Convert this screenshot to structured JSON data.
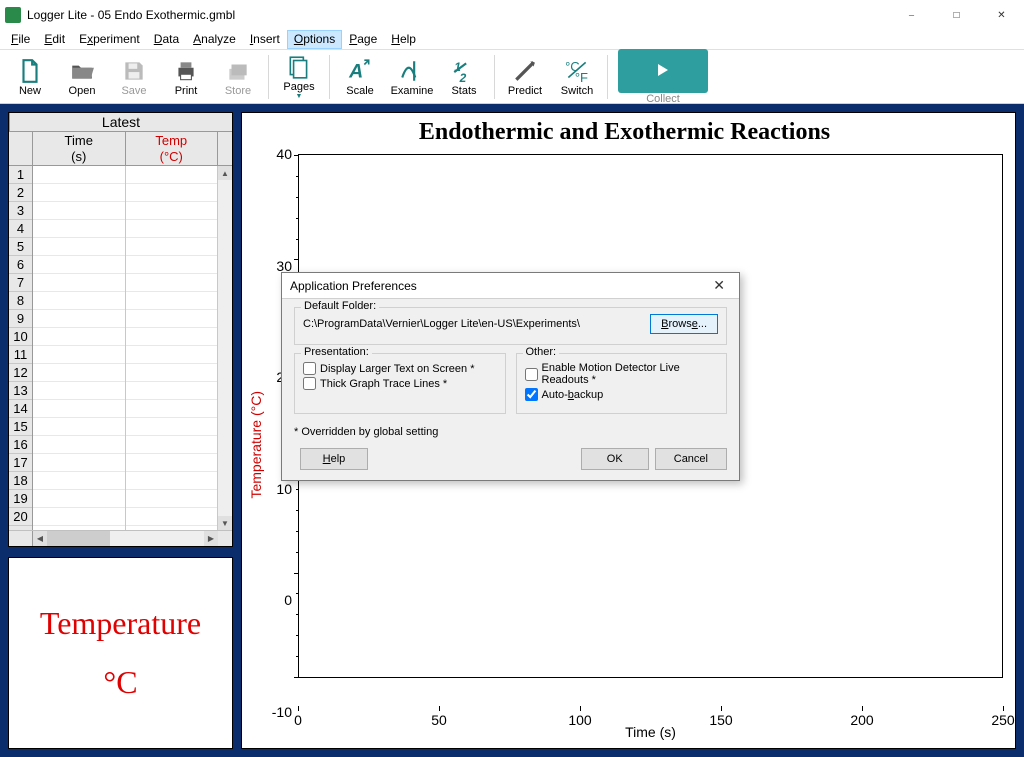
{
  "title": "Logger Lite - 05 Endo Exothermic.gmbl",
  "menu": [
    "File",
    "Edit",
    "Experiment",
    "Data",
    "Analyze",
    "Insert",
    "Options",
    "Page",
    "Help"
  ],
  "active_menu": "Options",
  "toolbar": {
    "new": "New",
    "open": "Open",
    "save": "Save",
    "print": "Print",
    "store": "Store",
    "pages": "Pages",
    "scale": "Scale",
    "examine": "Examine",
    "stats": "Stats",
    "predict": "Predict",
    "switch": "Switch",
    "collect": "Collect"
  },
  "table": {
    "title": "Latest",
    "col1_name": "Time",
    "col1_unit": "(s)",
    "col2_name": "Temp",
    "col2_unit": "(°C)",
    "rows": [
      1,
      2,
      3,
      4,
      5,
      6,
      7,
      8,
      9,
      10,
      11,
      12,
      13,
      14,
      15,
      16,
      17,
      18,
      19,
      20
    ]
  },
  "readout": {
    "label": "Temperature",
    "unit": "°C"
  },
  "chart_data": {
    "type": "line",
    "title": "Endothermic and Exothermic Reactions",
    "xlabel": "Time (s)",
    "ylabel": "Temperature (°C)",
    "xlim": [
      0,
      250
    ],
    "ylim": [
      -10,
      40
    ],
    "x_ticks": [
      0,
      50,
      100,
      150,
      200,
      250
    ],
    "y_ticks": [
      -10,
      0,
      10,
      20,
      30,
      40
    ],
    "series": []
  },
  "dialog": {
    "title": "Application Preferences",
    "default_folder_label": "Default Folder:",
    "default_folder_path": "C:\\ProgramData\\Vernier\\Logger Lite\\en-US\\Experiments\\",
    "browse": "Browse...",
    "presentation_label": "Presentation:",
    "larger_text": "Display Larger Text on Screen *",
    "thick_lines": "Thick Graph Trace Lines *",
    "other_label": "Other:",
    "motion_readouts": "Enable Motion Detector Live Readouts *",
    "auto_backup": "Auto-backup",
    "auto_backup_checked": true,
    "footnote": "* Overridden by global setting",
    "help": "Help",
    "ok": "OK",
    "cancel": "Cancel"
  }
}
